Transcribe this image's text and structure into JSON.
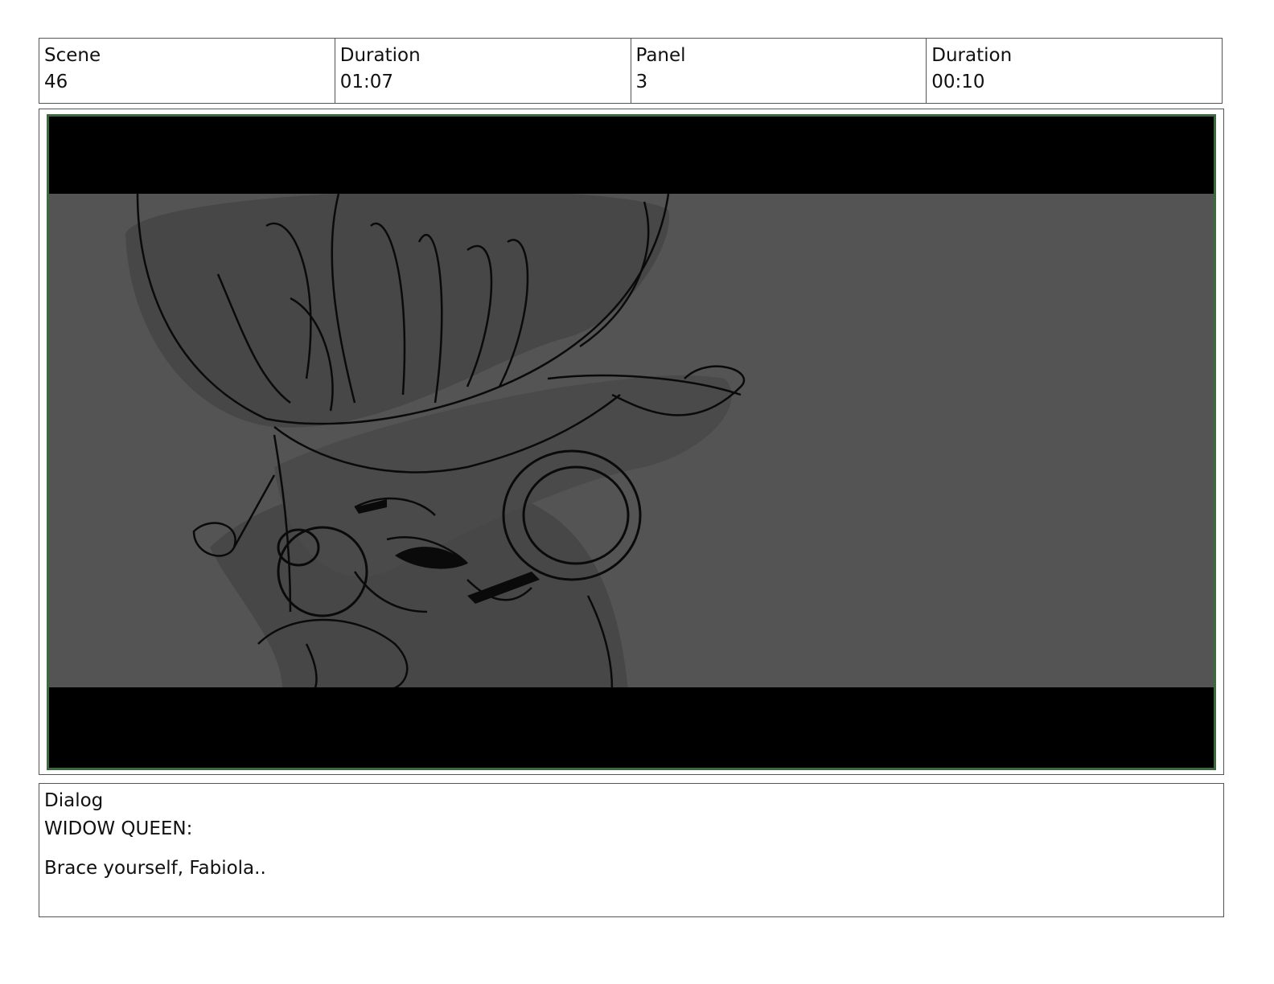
{
  "header": {
    "scene_label": "Scene",
    "scene_value": "46",
    "duration_label": "Duration",
    "duration_value": "01:07",
    "panel_label": "Panel",
    "panel_value": "3",
    "panel_duration_label": "Duration",
    "panel_duration_value": "00:10"
  },
  "dialog": {
    "label": "Dialog",
    "speaker": "WIDOW QUEEN:",
    "line": "Brace yourself, Fabiola.."
  }
}
